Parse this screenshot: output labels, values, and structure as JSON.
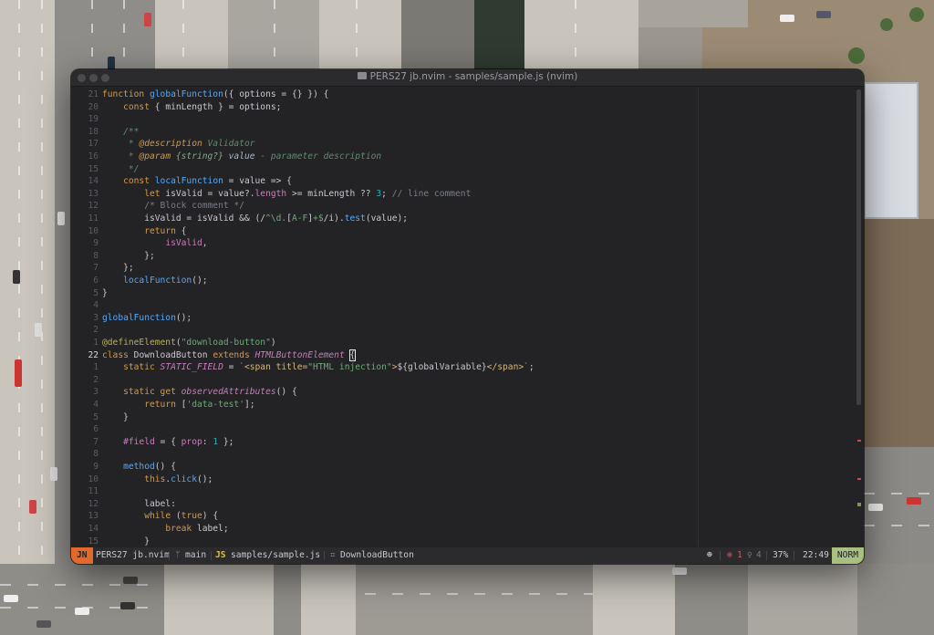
{
  "window": {
    "title": "PERS27 jb.nvim - samples/sample.js (nvim)"
  },
  "editor": {
    "gutter": [
      "21",
      "20",
      "19",
      "18",
      "17",
      "16",
      "15",
      "14",
      "13",
      "12",
      "11",
      "10",
      "9",
      "8",
      "7",
      "6",
      "5",
      "4",
      "3",
      "2",
      "1",
      "22",
      "1",
      "2",
      "3",
      "4",
      "5",
      "6",
      "7",
      "8",
      "9",
      "10",
      "11",
      "12",
      "13",
      "14",
      "15"
    ],
    "current_line_index": 21
  },
  "statusline": {
    "mode_badge": "JN",
    "workspace": "PERS27 jb.nvim",
    "branch_icon": "git-branch-icon",
    "branch": "main",
    "filetype_badge": "JS",
    "file_path": "samples/sample.js",
    "symbol_icon": "symbol-class-icon",
    "breadcrumb": "DownloadButton",
    "lsp_icon": "lsp-robot-icon",
    "errors": "1",
    "warnings": "4",
    "progress": "37%",
    "cursor_pos": "22:49",
    "vim_mode": "NORM"
  },
  "colors": {
    "mode_badge_bg": "#e2682b",
    "vim_mode_bg": "#a7c080",
    "error": "#e05561",
    "filetype": "#e2c044"
  }
}
